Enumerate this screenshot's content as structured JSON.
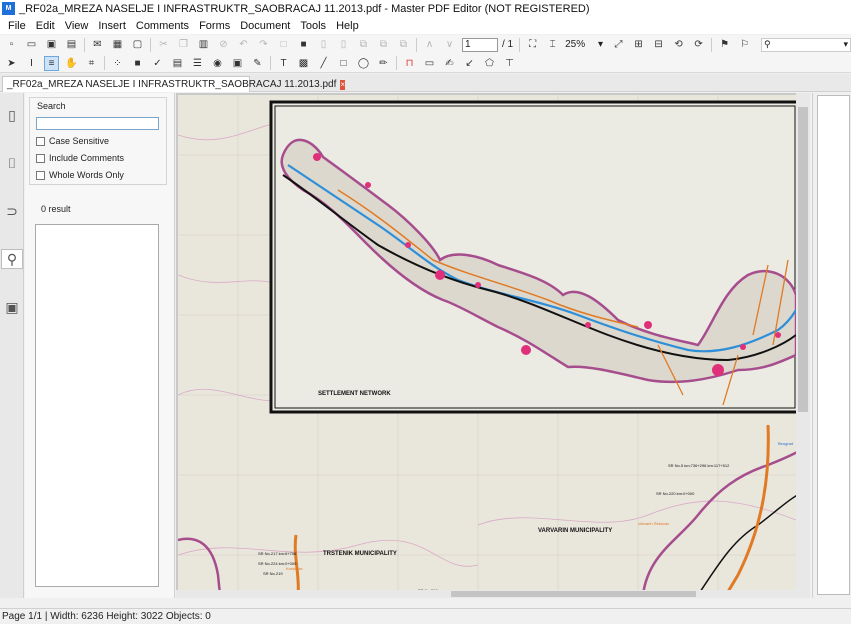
{
  "window": {
    "title": "_RF02a_MREZA NASELJE I INFRASTRUKTR_SAOBRACAJ 11.2013.pdf - Master PDF Editor (NOT REGISTERED)",
    "app_icon_text": "M"
  },
  "menu": {
    "items": [
      "File",
      "Edit",
      "View",
      "Insert",
      "Comments",
      "Forms",
      "Document",
      "Tools",
      "Help"
    ]
  },
  "toolbar": {
    "page_current": "1",
    "page_total": "/ 1",
    "zoom": "25%",
    "search_placeholder": ""
  },
  "tab": {
    "label": "_RF02a_MREZA NASELJE I INFRASTRUKTR_SAOBRACAJ 11.2013.pdf",
    "close_glyph": "×"
  },
  "search_panel": {
    "title": "Search",
    "input_value": "",
    "options": [
      {
        "label": "Case Sensitive",
        "checked": false
      },
      {
        "label": "Include Comments",
        "checked": false
      },
      {
        "label": "Whole Words Only",
        "checked": false
      }
    ],
    "result_text": "0 result"
  },
  "map": {
    "inset_label": "SETTLEMENT NETWORK",
    "municipality_labels": [
      "TRSTENIK MUNICIPALITY",
      "VARVARIN MUNICIPALITY"
    ],
    "small_labels": [
      "SR No.5 km:736+296 km:117+512",
      "SR No.220 km:0+000",
      "SR No.217 km:6+706",
      "SR No.224 km:0+000",
      "SR No.219",
      "SR No.218",
      "Varvarin Rekovac",
      "Beograd",
      "Kruševac"
    ],
    "colors": {
      "boundary": "#a64d8e",
      "river": "#2e8fd8",
      "road_main": "#111111",
      "road_regional": "#e07a24",
      "settlement": "#e0307a",
      "terrain": "#e9e6dc"
    }
  },
  "status": {
    "text": "Page 1/1 | Width: 6236 Height: 3022 Objects: 0"
  }
}
